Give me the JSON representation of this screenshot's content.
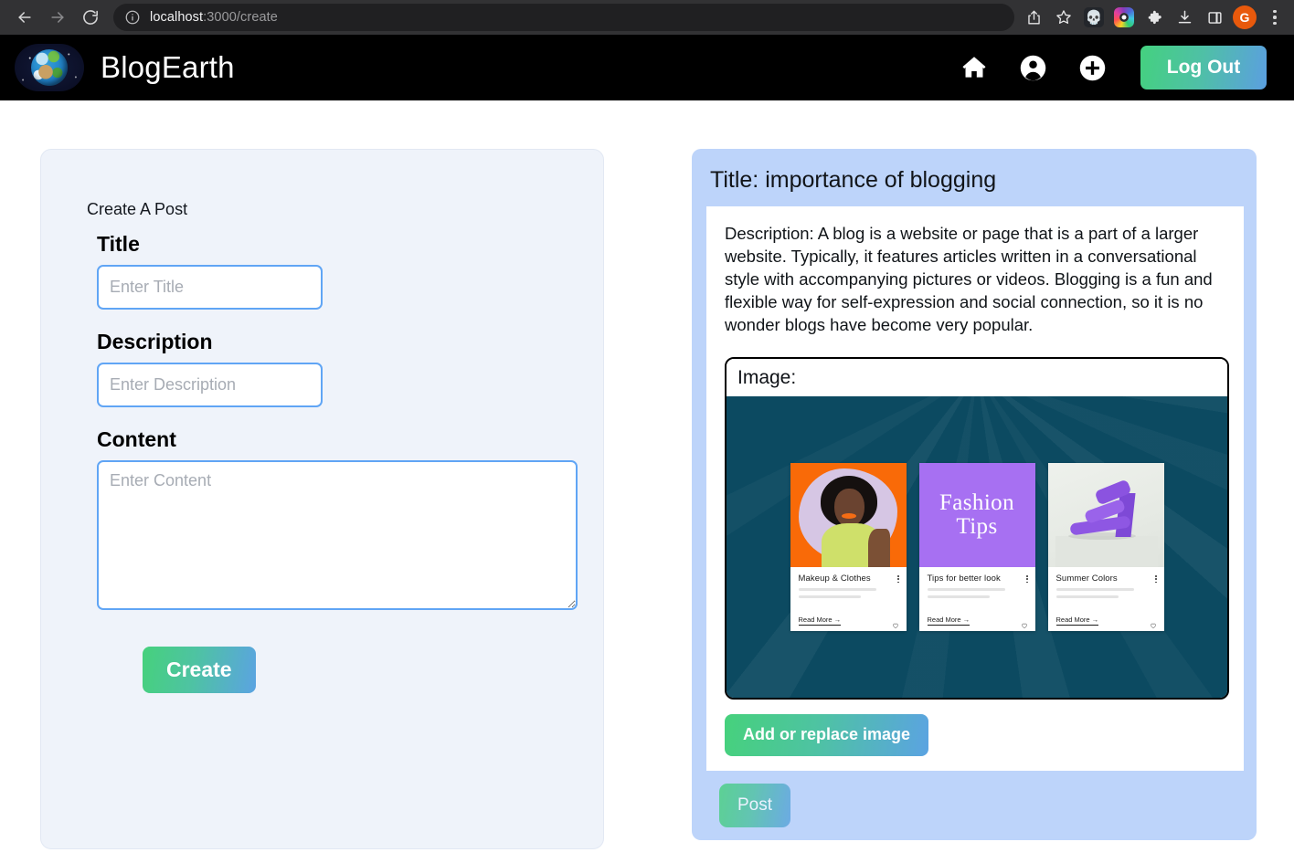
{
  "browser": {
    "back_icon": "back-arrow-icon",
    "forward_icon": "forward-arrow-icon",
    "reload_icon": "reload-icon",
    "site_info_icon": "site-info-icon",
    "url_host": "localhost",
    "url_rest": ":3000/create",
    "toolbar_icons": [
      "share-icon",
      "bookmark-star-icon",
      "extension-skull-icon",
      "extension-camera-icon",
      "extensions-puzzle-icon",
      "downloads-icon",
      "side-panel-icon"
    ],
    "profile_initial": "G",
    "menu_icon": "chrome-menu-icon"
  },
  "header": {
    "logo_icon": "earth-globe-logo",
    "brand": "BlogEarth",
    "nav": [
      {
        "name": "home-icon",
        "label": "Home"
      },
      {
        "name": "account-icon",
        "label": "Account"
      },
      {
        "name": "add-post-icon",
        "label": "Create"
      }
    ],
    "logout_label": "Log Out",
    "logout_gradient_from": "#44d17f",
    "logout_gradient_to": "#5b9fe0"
  },
  "form": {
    "legend": "Create A Post",
    "title_label": "Title",
    "title_value": "",
    "title_placeholder": "Enter Title",
    "description_label": "Description",
    "description_value": "",
    "description_placeholder": "Enter Description",
    "content_label": "Content",
    "content_value": "",
    "content_placeholder": "Enter Content",
    "create_label": "Create",
    "panel_bg": "#eff3fa",
    "input_border": "#60a5f5"
  },
  "preview": {
    "title": "Title: importance of blogging",
    "description": "Description: A blog is a website or page that is a part of a larger website. Typically, it features articles written in a conversational style with accompanying pictures or videos. Blogging is a fun and flexible way for self-expression and social connection, so it is no wonder blogs have become very popular.",
    "image_label": "Image:",
    "add_image_label": "Add or replace image",
    "post_label": "Post",
    "panel_bg": "#bdd4fa",
    "image_bg": "#0c4a61",
    "cards": [
      {
        "art_name": "makeup-portrait-art",
        "art_bg": "#f96a08",
        "title": "Makeup & Clothes",
        "read_more": "Read More →",
        "menu_icon": "more-options-icon",
        "like_icon": "heart-outline-icon"
      },
      {
        "art_name": "fashion-tips-art",
        "art_bg": "#a770f2",
        "art_line_1": "Fashion",
        "art_line_2": "Tips",
        "title": "Tips for better look",
        "read_more": "Read More →",
        "menu_icon": "more-options-icon",
        "like_icon": "heart-outline-icon"
      },
      {
        "art_name": "purple-heel-art",
        "art_bg": "#e9ece7",
        "title": "Summer Colors",
        "read_more": "Read More →",
        "menu_icon": "more-options-icon",
        "like_icon": "heart-outline-icon"
      }
    ]
  }
}
